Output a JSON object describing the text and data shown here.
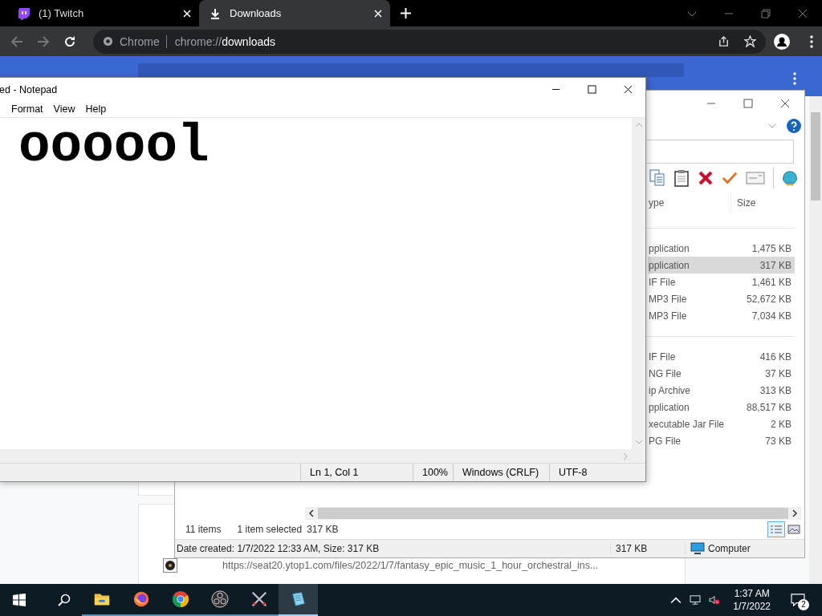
{
  "browser": {
    "tabs": [
      {
        "title": "(1) Twitch",
        "selected": false
      },
      {
        "title": "Downloads",
        "selected": true
      }
    ],
    "address": {
      "chip": "Chrome",
      "url": "chrome://**downloads**"
    },
    "page": {
      "download_url": "https://seat20.ytop1.com/files/2022/1/7/fantasy_epic_music_1_hour_orchestral_ins..."
    }
  },
  "explorer": {
    "columns": [
      "ype",
      "Size"
    ],
    "groups": [
      {
        "rows": [
          {
            "type": "pplication",
            "size": "1,475 KB",
            "selected": false
          },
          {
            "type": "pplication",
            "size": "317 KB",
            "selected": true
          },
          {
            "type": "IF File",
            "size": "1,461 KB",
            "selected": false
          },
          {
            "type": "MP3 File",
            "size": "52,672 KB",
            "selected": false
          },
          {
            "type": "MP3 File",
            "size": "7,034 KB",
            "selected": false
          }
        ]
      },
      {
        "rows": [
          {
            "type": "IF File",
            "size": "416 KB",
            "selected": false
          },
          {
            "type": "NG File",
            "size": "37 KB",
            "selected": false
          },
          {
            "type": "ip Archive",
            "size": "313 KB",
            "selected": false
          },
          {
            "type": "pplication",
            "size": "88,517 KB",
            "selected": false
          },
          {
            "type": "xecutable Jar File",
            "size": "2 KB",
            "selected": false
          },
          {
            "type": "PG File",
            "size": "73 KB",
            "selected": false
          }
        ]
      }
    ],
    "status": {
      "items": "11 items",
      "selected": "1 item selected",
      "selected_size": "317 KB"
    },
    "view_buttons": [
      {
        "kind": "details",
        "selected": true
      },
      {
        "kind": "preview",
        "selected": false
      }
    ],
    "details": {
      "info": "Date created: 1/7/2022 12:33 AM, Size: 317 KB",
      "size": "317 KB",
      "zone": "Computer"
    }
  },
  "notepad": {
    "title": "ed - Notepad",
    "menu": [
      "Format",
      "View",
      "Help"
    ],
    "text": "oooool",
    "status": [
      "Ln 1, Col 1",
      "100%",
      "Windows (CRLF)",
      "UTF-8"
    ]
  },
  "taskbar": {
    "apps": [
      {
        "kind": "folder",
        "running": true,
        "selected": false
      },
      {
        "kind": "firefox",
        "running": true,
        "selected": false
      },
      {
        "kind": "chrome",
        "running": true,
        "selected": false
      },
      {
        "kind": "obs",
        "running": true,
        "selected": false
      },
      {
        "kind": "swords",
        "running": true,
        "selected": false
      },
      {
        "kind": "notepad",
        "running": true,
        "selected": true
      }
    ],
    "time": "1:37 AM",
    "date": "1/7/2022",
    "notifications": "2"
  }
}
